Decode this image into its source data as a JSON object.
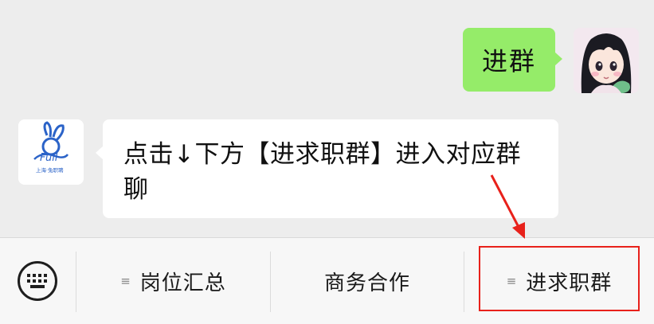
{
  "messages": {
    "outgoing": {
      "text": "进群"
    },
    "incoming": {
      "line1": "点击↓下方【进求职群】进入对应群",
      "line2": "聊"
    }
  },
  "bot_avatar": {
    "logo_text": "Full",
    "caption": "上海·兔职聘"
  },
  "menu": {
    "items": [
      {
        "label": "岗位汇总",
        "has_submenu": true
      },
      {
        "label": "商务合作",
        "has_submenu": false
      },
      {
        "label": "进求职群",
        "has_submenu": true
      }
    ],
    "submenu_glyph": "≡"
  },
  "annotation": {
    "color": "#e8211b"
  },
  "colors": {
    "bubble_out": "#95ec69",
    "bubble_in": "#ffffff",
    "chat_bg": "#ededed"
  }
}
